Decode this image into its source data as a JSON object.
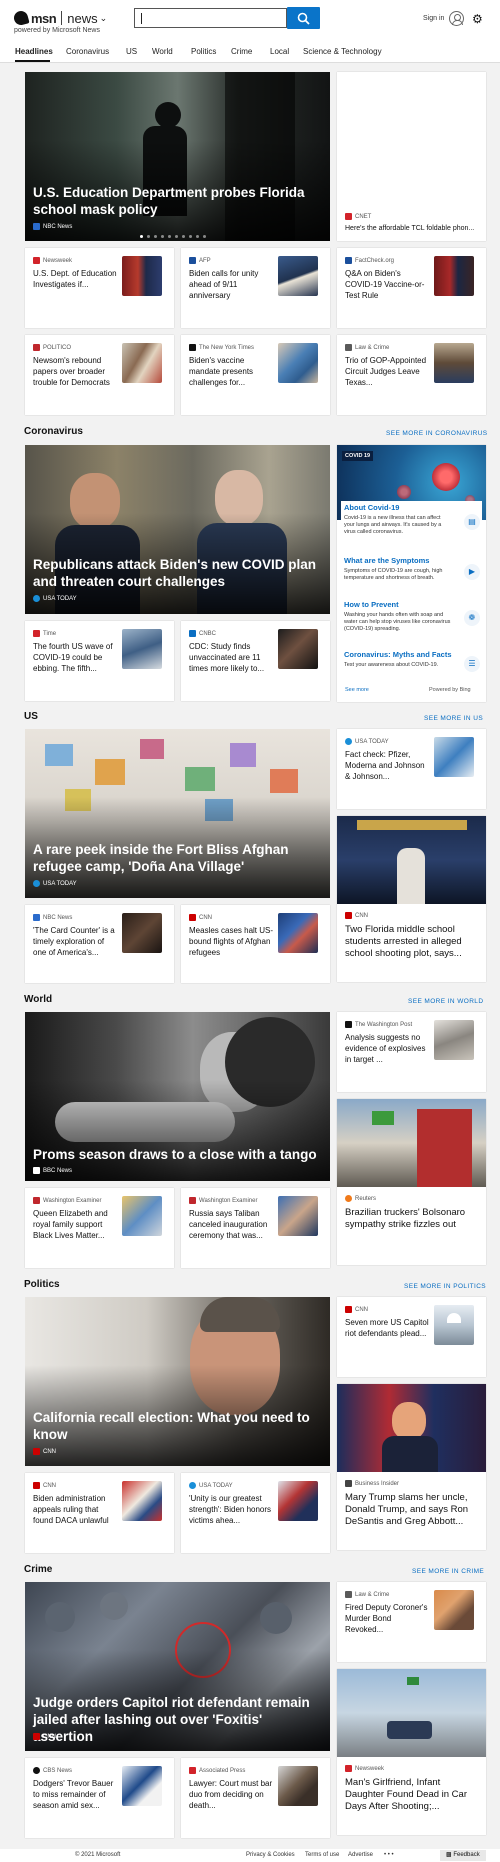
{
  "header": {
    "logo_msn": "msn",
    "logo_news": "news",
    "powered_by": "powered by Microsoft News",
    "search": {
      "placeholder": "",
      "value": ""
    },
    "signin": "Sign in"
  },
  "nav": [
    "Headlines",
    "Coronavirus",
    "US",
    "World",
    "Politics",
    "Crime",
    "Local",
    "Science & Technology"
  ],
  "headlines": {
    "hero": {
      "title": "U.S. Education Department probes Florida school mask policy",
      "source": "NBC News",
      "source_color": "#2a6bcc"
    },
    "side_right": {
      "source": "CNET",
      "title": "Here's the affordable TCL foldable phon..."
    },
    "small": [
      {
        "source": "Newsweek",
        "title": "U.S. Dept. of Education Investigates if...",
        "color": "#d2232a"
      },
      {
        "source": "AFP",
        "title": "Biden calls for unity ahead of 9/11 anniversary",
        "color": "#1b4f9c"
      },
      {
        "source": "FactCheck.org",
        "title": "Q&A on Biden's COVID-19 Vaccine-or-Test Rule",
        "color": "#1b4f9c"
      },
      {
        "source": "POLITICO",
        "title": "Newsom's rebound papers over broader trouble for Democrats",
        "color": "#c0272d"
      },
      {
        "source": "The New York Times",
        "title": "Biden's vaccine mandate presents challenges for...",
        "color": "#111111"
      },
      {
        "source": "Law & Crime",
        "title": "Trio of GOP-Appointed Circuit Judges Leave Texas...",
        "color": "#5a5a5a"
      }
    ]
  },
  "coronavirus": {
    "title": "Coronavirus",
    "see_more": "SEE MORE IN CORONAVIRUS",
    "hero": {
      "title": "Republicans attack Biden's new COVID plan and threaten court challenges",
      "source": "USA TODAY",
      "source_color": "#1a8fd8"
    },
    "small": [
      {
        "source": "Time",
        "title": "The fourth US wave of COVID-19 could be ebbing. The fifth...",
        "color": "#d2232a"
      },
      {
        "source": "CNBC",
        "title": "CDC: Study finds unvaccinated are 11 times more likely to...",
        "color": "#0a6ec2"
      }
    ],
    "covid_card": {
      "badge": "COVID 19",
      "items": [
        {
          "head": "About Covid-19",
          "text": "Covid-19 is a new illness that can affect your lungs and airways. It's caused by a virus called coronavirus."
        },
        {
          "head": "What are the Symptoms",
          "text": "Symptoms of COVID-19 are cough, high temperature and shortness of breath."
        },
        {
          "head": "How to Prevent",
          "text": "Washing your hands often with soap and water can help stop viruses like coronavirus (COVID-19) spreading."
        },
        {
          "head": "Coronavirus: Myths and Facts",
          "text": "Test your awareness about COVID-19."
        }
      ],
      "see_more": "See more",
      "powered": "Powered by Bing"
    }
  },
  "us": {
    "title": "US",
    "see_more": "SEE MORE IN US",
    "hero": {
      "title": "A rare peek inside the Fort Bliss Afghan refugee camp, 'Doña Ana Village'",
      "source": "USA TODAY",
      "source_color": "#1a8fd8"
    },
    "side_right": {
      "source": "USA TODAY",
      "title": "Fact check: Pfizer, Moderna and Johnson & Johnson..."
    },
    "big_right": {
      "source": "CNN",
      "title": "Two Florida middle school students arrested in alleged school shooting plot, says..."
    },
    "small": [
      {
        "source": "NBC News",
        "title": "'The Card Counter' is a timely exploration of one of America's...",
        "color": "#2a6bcc"
      },
      {
        "source": "CNN",
        "title": "Measles cases halt US-bound flights of Afghan refugees",
        "color": "#cc0000"
      }
    ]
  },
  "world": {
    "title": "World",
    "see_more": "SEE MORE IN WORLD",
    "hero": {
      "title": "Proms season draws to a close with a tango",
      "source": "BBC News",
      "source_color": "#111111"
    },
    "side_right": {
      "source": "The Washington Post",
      "title": "Analysis suggests no evidence of explosives in target ..."
    },
    "big_right": {
      "source": "Reuters",
      "title": "Brazilian truckers' Bolsonaro sympathy strike fizzles out"
    },
    "small": [
      {
        "source": "Washington Examiner",
        "title": "Queen Elizabeth and royal family support Black Lives Matter...",
        "color": "#c0272d"
      },
      {
        "source": "Washington Examiner",
        "title": "Russia says Taliban canceled inauguration ceremony that was...",
        "color": "#c0272d"
      }
    ]
  },
  "politics": {
    "title": "Politics",
    "see_more": "SEE MORE IN POLITICS",
    "hero": {
      "title": "California recall election: What you need to know",
      "source": "CNN",
      "source_color": "#cc0000"
    },
    "side_right": {
      "source": "CNN",
      "title": "Seven more US Capitol riot defendants plead..."
    },
    "big_right": {
      "source": "Business Insider",
      "title": "Mary Trump slams her uncle, Donald Trump, and says Ron DeSantis and Greg Abbott..."
    },
    "small": [
      {
        "source": "CNN",
        "title": "Biden administration appeals ruling that found DACA unlawful",
        "color": "#cc0000"
      },
      {
        "source": "USA TODAY",
        "title": "'Unity is our greatest strength': Biden honors victims ahea...",
        "color": "#1a8fd8"
      }
    ]
  },
  "crime": {
    "title": "Crime",
    "see_more": "SEE MORE IN CRIME",
    "hero": {
      "title": "Judge orders Capitol riot defendant remain jailed after lashing out over 'Foxitis' assertion",
      "source": "CNN",
      "source_color": "#cc0000"
    },
    "side_right": {
      "source": "Law & Crime",
      "title": "Fired Deputy Coroner's Murder Bond Revoked..."
    },
    "big_right": {
      "source": "Newsweek",
      "title": "Man's Girlfriend, Infant Daughter Found Dead in Car Days After Shooting;..."
    },
    "small": [
      {
        "source": "CBS News",
        "title": "Dodgers' Trevor Bauer to miss remainder of season amid sex...",
        "color": "#111111"
      },
      {
        "source": "Associated Press",
        "title": "Lawyer: Court must bar duo from deciding on death...",
        "color": "#d2232a"
      }
    ]
  },
  "footer": {
    "copyright": "© 2021 Microsoft",
    "privacy": "Privacy & Cookies",
    "terms": "Terms of use",
    "advertise": "Advertise",
    "more": "• • •",
    "feedback": "Feedback"
  }
}
